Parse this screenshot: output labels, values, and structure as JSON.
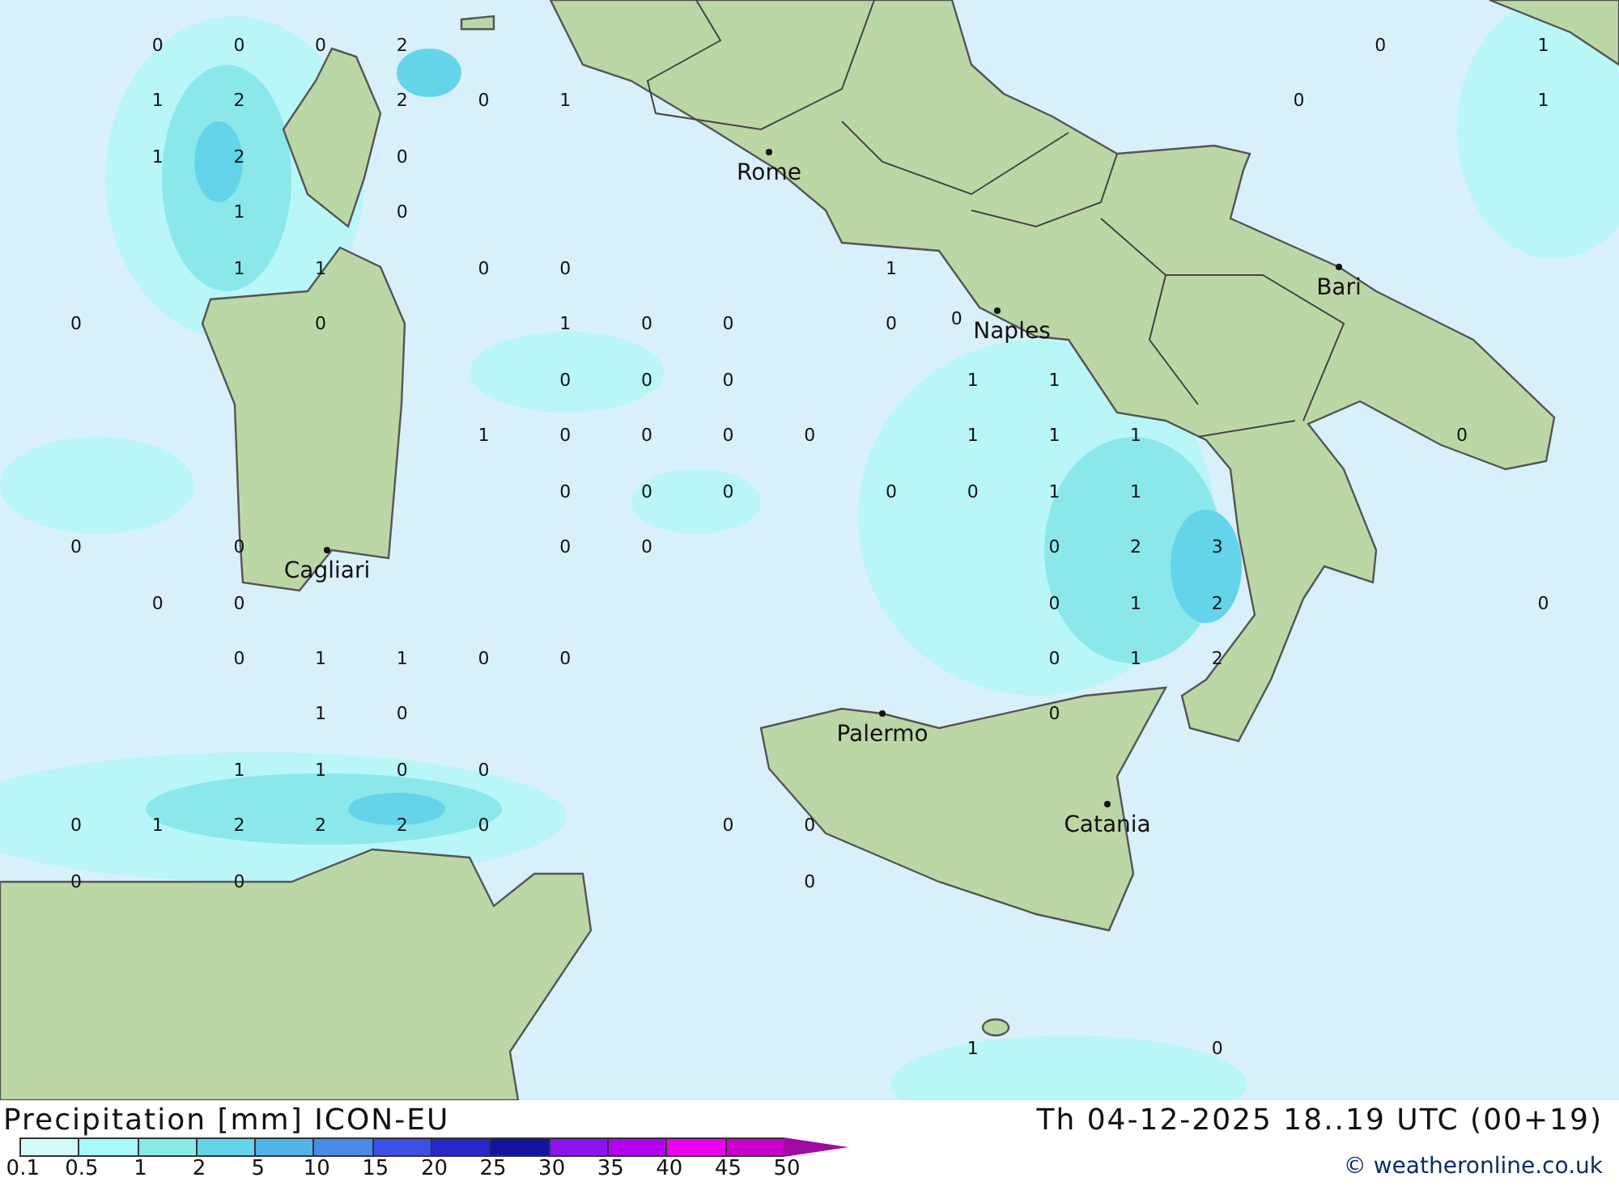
{
  "map": {
    "values": [
      [
        {
          "text": "0"
        },
        {
          "text": "0"
        },
        {
          "text": "0"
        },
        {
          "text": "2"
        },
        {
          "text": "0"
        },
        {
          "text": "1"
        }
      ],
      [
        {
          "text": "1"
        },
        {
          "text": "2"
        },
        {
          "text": "2"
        },
        {
          "text": "0"
        },
        {
          "text": "1"
        },
        {
          "text": "0"
        },
        {
          "text": "1"
        }
      ],
      [
        {
          "text": "1"
        },
        {
          "text": "2"
        },
        {
          "text": "0"
        }
      ],
      [
        {
          "text": "1"
        },
        {
          "text": "0"
        }
      ],
      [
        {
          "text": "1"
        },
        {
          "text": "1"
        },
        {
          "text": "0"
        },
        {
          "text": "0"
        },
        {
          "text": "1"
        }
      ],
      [
        {
          "text": "0"
        },
        {
          "text": "0"
        },
        {
          "text": "1"
        },
        {
          "text": "0"
        },
        {
          "text": "0"
        },
        {
          "text": "0"
        },
        {
          "text": "0"
        }
      ],
      [
        {
          "text": "0"
        },
        {
          "text": "0"
        },
        {
          "text": "0"
        },
        {
          "text": "1"
        },
        {
          "text": "1"
        }
      ],
      [
        {
          "text": "1"
        },
        {
          "text": "0"
        },
        {
          "text": "0"
        },
        {
          "text": "0"
        },
        {
          "text": "0"
        },
        {
          "text": "1"
        },
        {
          "text": "1"
        },
        {
          "text": "1"
        },
        {
          "text": "0"
        }
      ],
      [
        {
          "text": "0"
        },
        {
          "text": "0"
        },
        {
          "text": "0"
        },
        {
          "text": "0"
        },
        {
          "text": "0"
        },
        {
          "text": "1"
        },
        {
          "text": "1"
        }
      ],
      [
        {
          "text": "0"
        },
        {
          "text": "0"
        },
        {
          "text": "0"
        },
        {
          "text": "0"
        },
        {
          "text": "0"
        },
        {
          "text": "2"
        },
        {
          "text": "3"
        }
      ],
      [
        {
          "text": "0"
        },
        {
          "text": "0"
        },
        {
          "text": "0"
        },
        {
          "text": "1"
        },
        {
          "text": "2"
        },
        {
          "text": "0"
        }
      ],
      [
        {
          "text": "0"
        },
        {
          "text": "1"
        },
        {
          "text": "1"
        },
        {
          "text": "0"
        },
        {
          "text": "0"
        },
        {
          "text": "0"
        },
        {
          "text": "1"
        },
        {
          "text": "2"
        }
      ],
      [
        {
          "text": "1"
        },
        {
          "text": "0"
        },
        {
          "text": "0"
        }
      ],
      [
        {
          "text": "1"
        },
        {
          "text": "1"
        },
        {
          "text": "0"
        },
        {
          "text": "0"
        }
      ],
      [
        {
          "text": "0"
        },
        {
          "text": "1"
        },
        {
          "text": "2"
        },
        {
          "text": "2"
        },
        {
          "text": "2"
        },
        {
          "text": "0"
        },
        {
          "text": "0"
        },
        {
          "text": "0"
        }
      ],
      [
        {
          "text": "0"
        },
        {
          "text": "0"
        },
        {
          "text": "0"
        }
      ],
      [
        {
          "text": "1"
        },
        {
          "text": "0"
        }
      ]
    ],
    "cities": [
      {
        "name": "Rome"
      },
      {
        "name": "Naples"
      },
      {
        "name": "Bari"
      },
      {
        "name": "Cagliari"
      },
      {
        "name": "Palermo"
      },
      {
        "name": "Catania"
      }
    ]
  },
  "header": {
    "title": "Precipitation [mm] ICON-EU",
    "datetime": "Th 04-12-2025 18..19 UTC (00+19)"
  },
  "legend": {
    "segments": [
      {
        "kind": "band",
        "color": "#d2fafa"
      },
      {
        "kind": "band",
        "color": "#a8fafa"
      },
      {
        "kind": "band",
        "color": "#8aeaea"
      },
      {
        "kind": "band",
        "color": "#64d4e8"
      },
      {
        "kind": "band",
        "color": "#50b4e6"
      },
      {
        "kind": "band",
        "color": "#4a8ce6"
      },
      {
        "kind": "band",
        "color": "#3c50e6"
      },
      {
        "kind": "band",
        "color": "#2828c8"
      },
      {
        "kind": "band",
        "color": "#1414a0"
      },
      {
        "kind": "band",
        "color": "#8c14f0"
      },
      {
        "kind": "band",
        "color": "#b400f0"
      },
      {
        "kind": "band",
        "color": "#f000f0"
      },
      {
        "kind": "band",
        "color": "#c800c8"
      },
      {
        "kind": "arrow",
        "color": "#a00aa0"
      }
    ],
    "labels": [
      "0.1",
      "0.5",
      "1",
      "2",
      "5",
      "10",
      "15",
      "20",
      "25",
      "30",
      "35",
      "40",
      "45",
      "50"
    ]
  },
  "credit": "© weatheronline.co.uk"
}
